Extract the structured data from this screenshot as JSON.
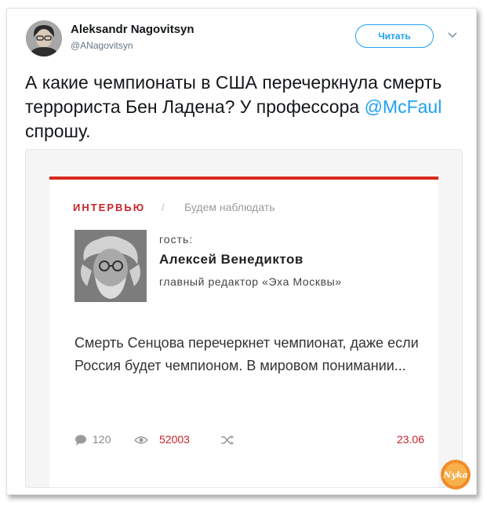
{
  "tweet": {
    "author_name": "Aleksandr Nagovitsyn",
    "author_handle": "@ANagovitsyn",
    "follow_label": "Читать",
    "text_before": "А какие чемпионаты в США перечеркнула смерть террориста Бен Ладена? У профессора ",
    "mention": "@McFaul",
    "text_after": " спрошу."
  },
  "card": {
    "kicker": "ИНТЕРВЬЮ",
    "separator": "/",
    "subtitle": "Будем наблюдать",
    "guest_label": "гость:",
    "guest_name": "Алексей Венедиктов",
    "guest_role": "главный редактор «Эха Москвы»",
    "quote": "Смерть Сенцова перечеркнет чемпионат, даже если Россия будет чемпионом. В мировом понимании...",
    "comments": "120",
    "views": "52003",
    "date": "23.06"
  },
  "icons": {
    "chevron": "chevron-down-icon",
    "comment": "comment-icon",
    "views": "eye-icon",
    "share": "shuffle-icon"
  },
  "colors": {
    "accent_blue": "#1da1f2",
    "accent_red": "#c8232a"
  },
  "watermark_text": "Nyka"
}
